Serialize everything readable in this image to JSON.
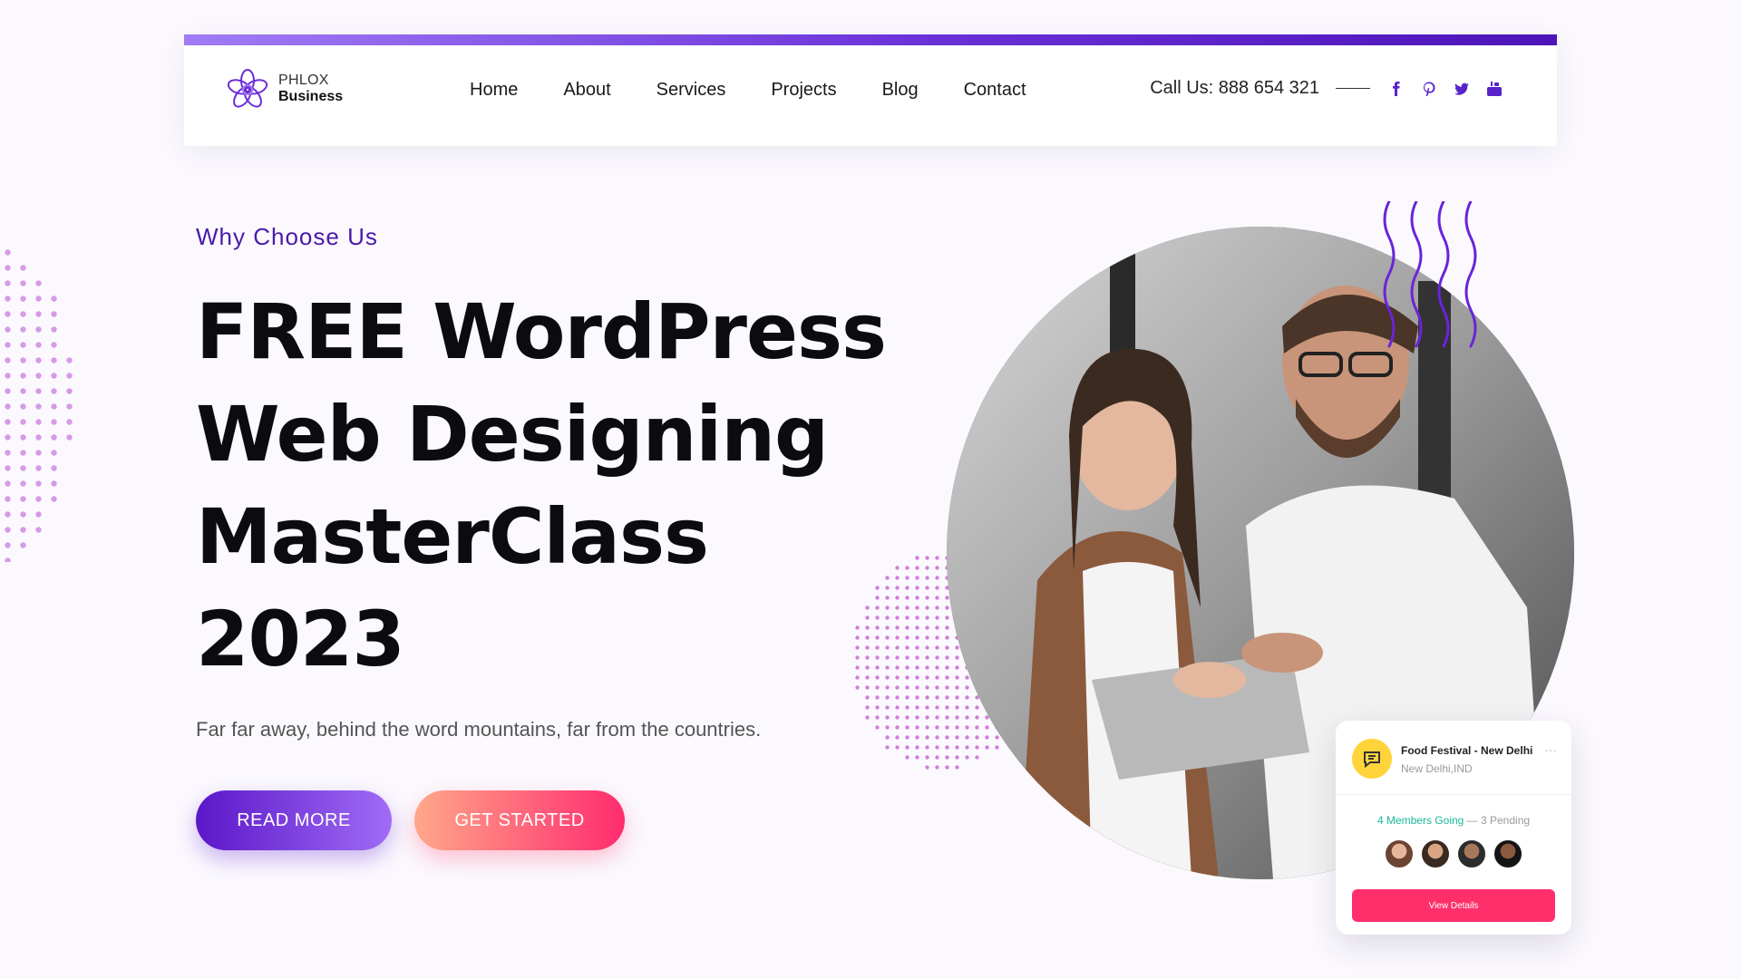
{
  "header": {
    "brand_line1": "PHLOX",
    "brand_line2": "Business",
    "nav": [
      "Home",
      "About",
      "Services",
      "Projects",
      "Blog",
      "Contact"
    ],
    "call_us": "Call Us: 888 654 321",
    "social_icons": [
      "facebook-icon",
      "pinterest-icon",
      "twitter-icon",
      "youtube-icon"
    ]
  },
  "hero": {
    "eyebrow": "Why Choose Us",
    "title_lines": [
      "FREE WordPress",
      "Web Designing",
      "MasterClass",
      "2023"
    ],
    "subtitle": "Far far away, behind the word mountains, far from the countries.",
    "read_more": "READ MORE",
    "get_started": "GET STARTED"
  },
  "event_card": {
    "title": "Food Festival - New Delhi",
    "location": "New Delhi,IND",
    "members_going": "4 Members Going",
    "pending": " — 3 Pending",
    "button": "View Details"
  },
  "colors": {
    "brand_purple": "#5b17c9",
    "accent_pink": "#ff2b6e",
    "background": "#fbf9fe"
  }
}
